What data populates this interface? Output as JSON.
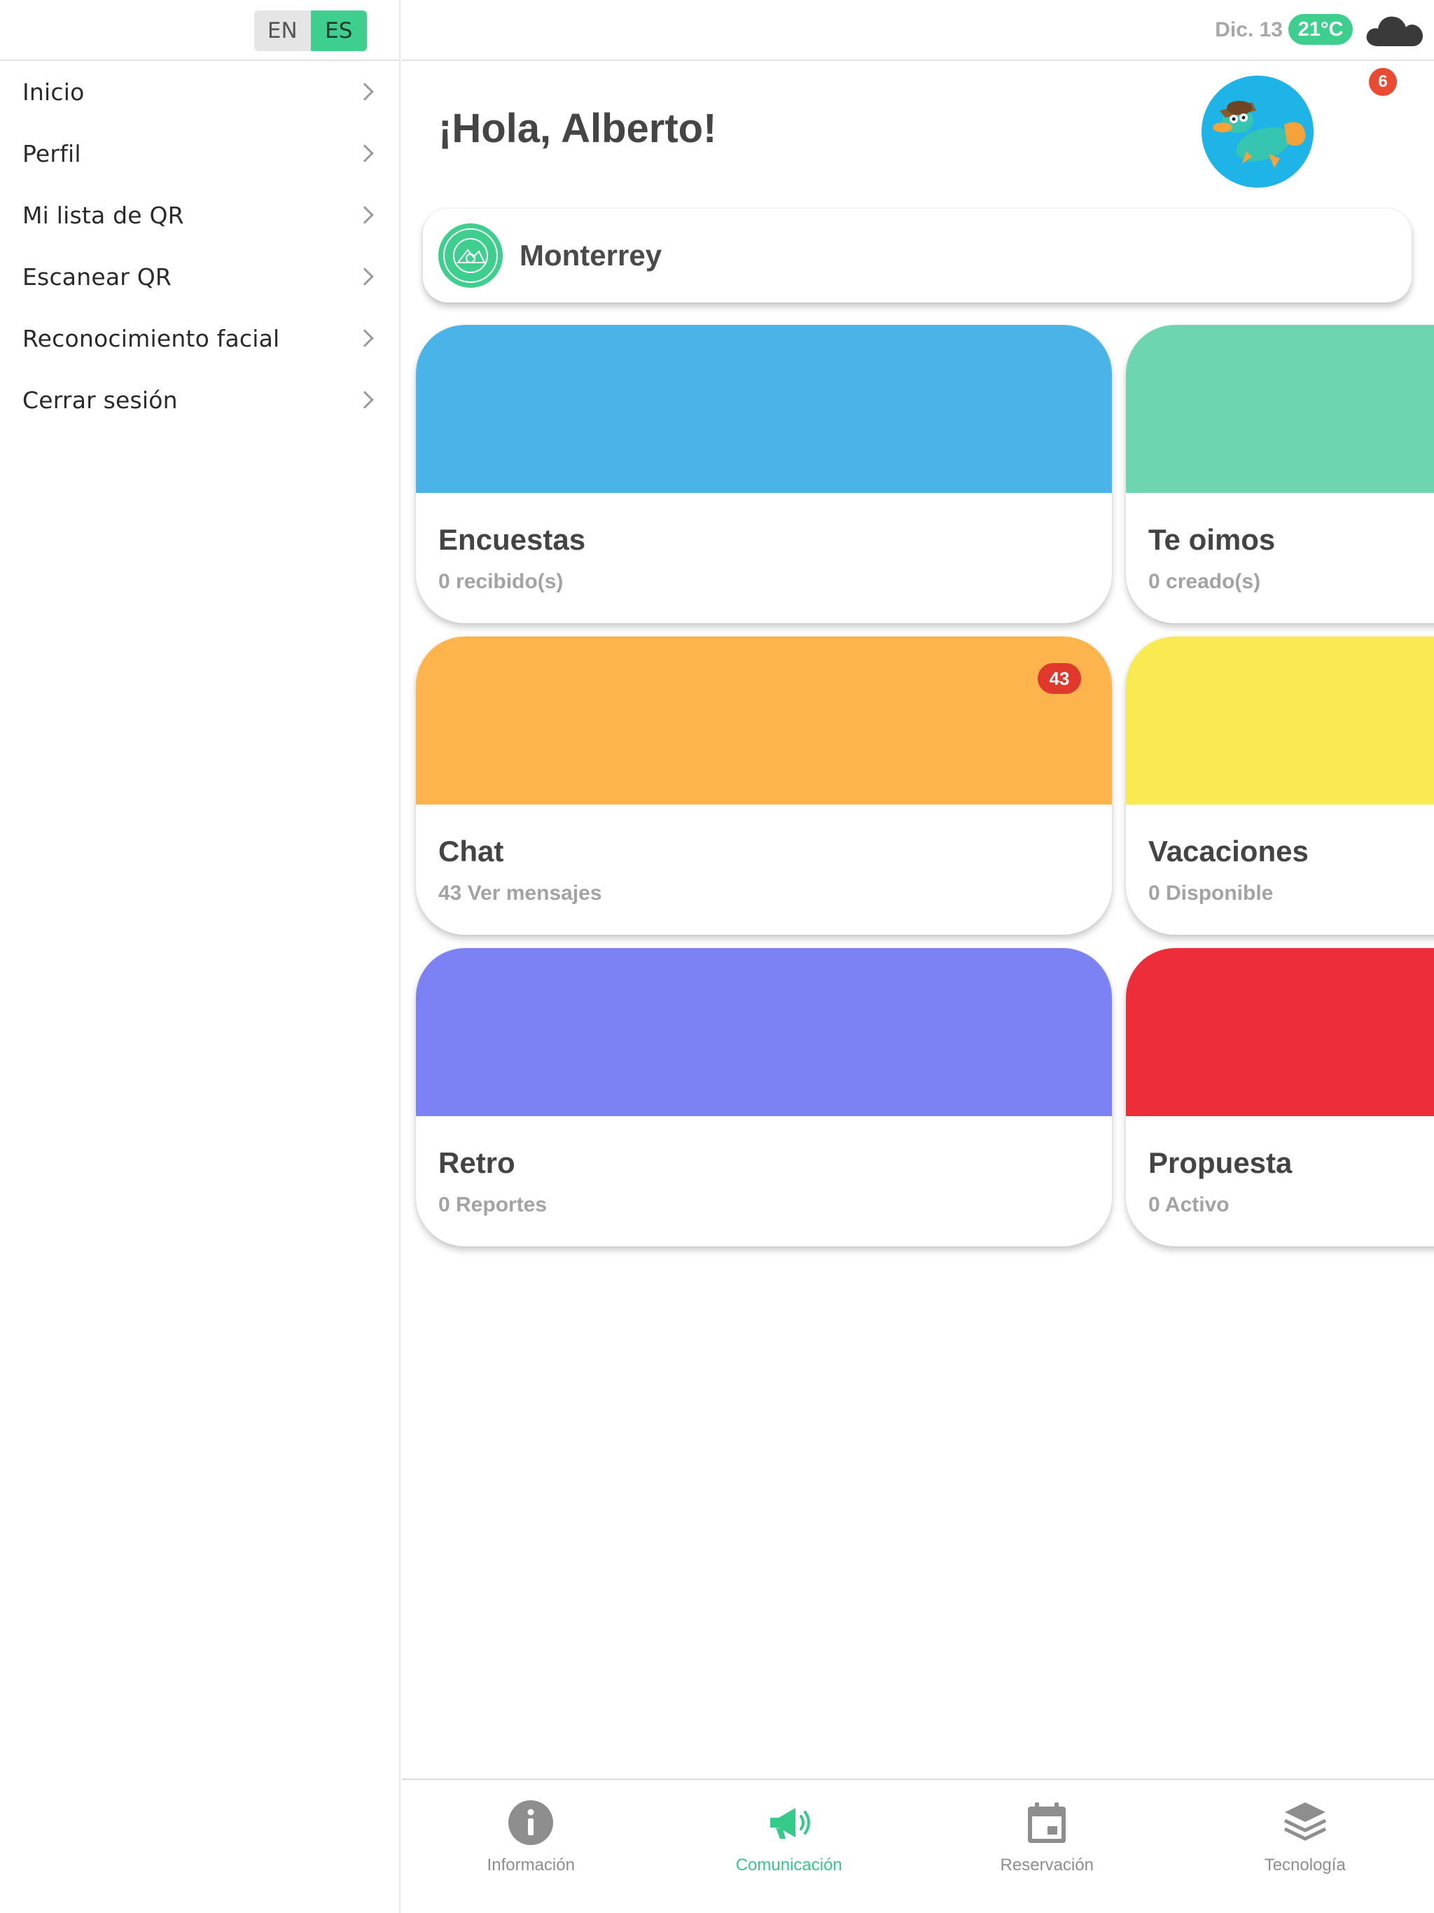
{
  "language_toggle": {
    "en_label": "EN",
    "es_label": "ES",
    "active": "ES"
  },
  "sidebar": {
    "items": [
      {
        "label": "Inicio"
      },
      {
        "label": "Perfil"
      },
      {
        "label": "Mi lista de QR"
      },
      {
        "label": "Escanear QR"
      },
      {
        "label": "Reconocimiento facial"
      },
      {
        "label": "Cerrar sesión"
      }
    ]
  },
  "header": {
    "date": "Dic. 13",
    "temperature": "21°C",
    "weather_icon": "cloud-icon"
  },
  "greeting": "¡Hola, Alberto!",
  "notifications": {
    "count": "6"
  },
  "location": {
    "name": "Monterrey",
    "logo_icon": "company-logo-icon"
  },
  "tiles": [
    {
      "title": "Encuestas",
      "subtitle": "0 recibido(s)",
      "color": "#4ab3e8"
    },
    {
      "title": "Te oimos",
      "subtitle": "0 creado(s)",
      "color": "#6dd5b0"
    },
    {
      "title": "Chat",
      "subtitle": "43 Ver mensajes",
      "color": "#fdb44c",
      "badge": "43"
    },
    {
      "title": "Vacaciones",
      "subtitle": "0 Disponible",
      "color": "#f9ea52"
    },
    {
      "title": "Retro",
      "subtitle": "0 Reportes",
      "color": "#7c82f4"
    },
    {
      "title": "Propuesta",
      "subtitle": "0 Activo",
      "color": "#ee2d3a"
    }
  ],
  "bottom_nav": [
    {
      "label": "Información",
      "icon": "info-icon",
      "active": false
    },
    {
      "label": "Comunicación",
      "icon": "megaphone-icon",
      "active": true
    },
    {
      "label": "Reservación",
      "icon": "calendar-icon",
      "active": false
    },
    {
      "label": "Tecnología",
      "icon": "layers-icon",
      "active": false
    }
  ],
  "colors": {
    "accent": "#3ecf8e",
    "badge_red": "#e84a32",
    "inactive_nav": "#8e8e8e"
  }
}
